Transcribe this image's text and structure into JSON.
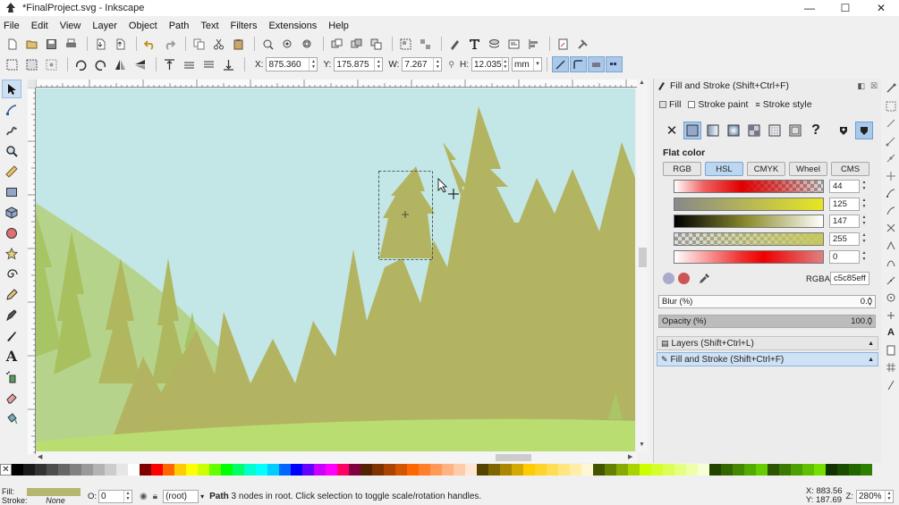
{
  "window": {
    "title": "*FinalProject.svg - Inkscape",
    "controls": {
      "minimize": "—",
      "maximize": "☐",
      "close": "✕"
    }
  },
  "menu": [
    "File",
    "Edit",
    "View",
    "Layer",
    "Object",
    "Path",
    "Text",
    "Filters",
    "Extensions",
    "Help"
  ],
  "context_toolbar": {
    "x_label": "X:",
    "x_value": "875.360",
    "y_label": "Y:",
    "y_value": "175.875",
    "w_label": "W:",
    "w_value": "7.267",
    "h_label": "H:",
    "h_value": "12.035",
    "unit": "mm"
  },
  "ruler_labels": [
    "",
    "",
    "",
    "",
    "",
    "",
    "",
    "",
    ""
  ],
  "dock": {
    "panel_title": "Fill and Stroke (Shift+Ctrl+F)",
    "tabs": [
      "Fill",
      "Stroke paint",
      "Stroke style"
    ],
    "paint_icons": [
      "no-paint",
      "flat-color",
      "linear-gradient",
      "radial-gradient",
      "pattern",
      "swatch",
      "mesh",
      "unset"
    ],
    "unset_glyph": "?",
    "section_label": "Flat color",
    "color_modes": [
      "RGB",
      "HSL",
      "CMYK",
      "Wheel",
      "CMS"
    ],
    "selected_mode": "HSL",
    "slider_values": [
      "44",
      "125",
      "147",
      "255",
      "0"
    ],
    "rgba_label": "RGBA:",
    "rgba_value": "c5c85eff",
    "blur_label": "Blur (%)",
    "blur_value": "0.0",
    "opacity_label": "Opacity (%)",
    "opacity_value": "100.0",
    "opacity_level": 1.0,
    "collapsed_panels": [
      "Layers (Shift+Ctrl+L)",
      "Fill and Stroke (Shift+Ctrl+F)"
    ]
  },
  "status": {
    "fill_label": "Fill:",
    "stroke_label": "Stroke:",
    "stroke_value": "None",
    "fill_color": "#b5b770",
    "opacity_label": "O:",
    "opacity_value": "0",
    "layer": "(root)",
    "message_bold": "Path",
    "message": " 3 nodes in root. Click selection to toggle scale/rotation handles.",
    "cursor_x_label": "X:",
    "cursor_x": "883.56",
    "cursor_y_label": "Y:",
    "cursor_y": "187.69",
    "zoom_label": "Z:",
    "zoom": "280%"
  },
  "colors": {
    "sky": "#c3e6e6",
    "tree": "#b3b461",
    "tree_dark": "#a9ab58",
    "hill_light": "#b6d38c",
    "grass": "#b9dd70",
    "selection_blue": "#a9c9ea"
  },
  "palette_colors": [
    "#000000",
    "#1a1a1a",
    "#333333",
    "#4d4d4d",
    "#666666",
    "#808080",
    "#999999",
    "#b3b3b3",
    "#cccccc",
    "#e6e6e6",
    "#ffffff",
    "#800000",
    "#ff0000",
    "#ff6600",
    "#ffcc00",
    "#ffff00",
    "#ccff00",
    "#66ff00",
    "#00ff00",
    "#00ff66",
    "#00ffcc",
    "#00ffff",
    "#00ccff",
    "#0066ff",
    "#0000ff",
    "#6600ff",
    "#cc00ff",
    "#ff00ff",
    "#ff0066",
    "#800040",
    "#552200",
    "#803300",
    "#aa4400",
    "#d45500",
    "#ff6600",
    "#ff7f2a",
    "#ff9955",
    "#ffb380",
    "#ffccaa",
    "#ffe6d5",
    "#554400",
    "#806600",
    "#aa8800",
    "#d4aa00",
    "#ffcc00",
    "#ffd42a",
    "#ffdd55",
    "#ffe680",
    "#ffeeaa",
    "#fff6d5",
    "#445500",
    "#668000",
    "#88aa00",
    "#aad400",
    "#ccff00",
    "#d4ff2a",
    "#ddff55",
    "#e5ff80",
    "#eeffaa",
    "#f6ffd5",
    "#224400",
    "#336600",
    "#448800",
    "#55aa00",
    "#66cc00",
    "#2b5500",
    "#3a7a00",
    "#4da000",
    "#60c000",
    "#73e000",
    "#113300",
    "#1a4d00",
    "#226600",
    "#2b8000"
  ]
}
